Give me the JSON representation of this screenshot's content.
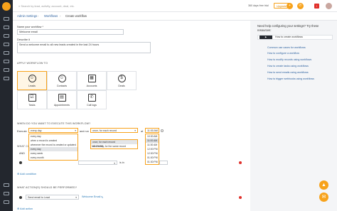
{
  "topbar": {
    "search_placeholder": "Search by lead, activity, account, deal, etc.",
    "trial_days": "360 days free trial",
    "upgrade_label": "Upgrade"
  },
  "breadcrumb": [
    "Admin Settings",
    "Workflows",
    "Create workflow"
  ],
  "form": {
    "name_label": "Name your workflow *",
    "name_value": "Welcome email",
    "desc_label": "Describe it",
    "desc_value": "Send a welcome email to all new leads created in the last 24 hours",
    "apply_heading": "APPLY WORKFLOW TO",
    "tiles": [
      {
        "label": "Leads",
        "glyph": "☺"
      },
      {
        "label": "Contacts",
        "glyph": "☺"
      },
      {
        "label": "Accounts",
        "glyph": "▦"
      },
      {
        "label": "Deals",
        "glyph": "$"
      },
      {
        "label": "Tasks",
        "glyph": "☑"
      },
      {
        "label": "Appointments",
        "glyph": "▤"
      },
      {
        "label": "Call logs",
        "glyph": "✆"
      }
    ],
    "when_heading": "WHEN DO YOU WANT TO EXECUTE THIS WORKFLOW?",
    "execute_label": "Execute",
    "execute_value": "every day",
    "and_run_label": "and run",
    "run_value": "once, for each record",
    "at_label": "at",
    "time_value": "11:00 AM",
    "execute_options": [
      "every day",
      "when a record is created",
      "whenever the record is created or updated",
      "every day",
      "every week",
      "every month"
    ],
    "run_options": [
      "once, for each record",
      "recurrently, for the same record"
    ],
    "time_options": [
      "10:30 AM",
      "11:00 AM",
      "11:30 AM",
      "12:00 PM",
      "12:30 PM",
      "01:00 PM",
      "01:30 PM"
    ],
    "what_heading": "WHAT CO",
    "what_heading_tail": "NDITION",
    "and_label": "AND",
    "cond_op": "is in",
    "add_condition": "Add condition",
    "actions_heading": "WHAT ACTION(S) SHOULD BE PERFORMED?",
    "action_value": "Send email to Lead",
    "action_template": "Welcome Email",
    "add_action": "Add action"
  },
  "help": {
    "title": "Need help configuring your settings? Try these resources:",
    "video_label": "How to create workflows",
    "links": [
      "Common use cases for workflows",
      "How to configure a workflow",
      "How to modify records using workflows",
      "How to create tasks using workflows",
      "How to send emails using workflows",
      "How to trigger webhooks using workflows"
    ]
  },
  "colors": {
    "accent": "#f7a21b",
    "sidebar": "#23272e",
    "link": "#2a7ab8",
    "danger": "#e0302b"
  }
}
